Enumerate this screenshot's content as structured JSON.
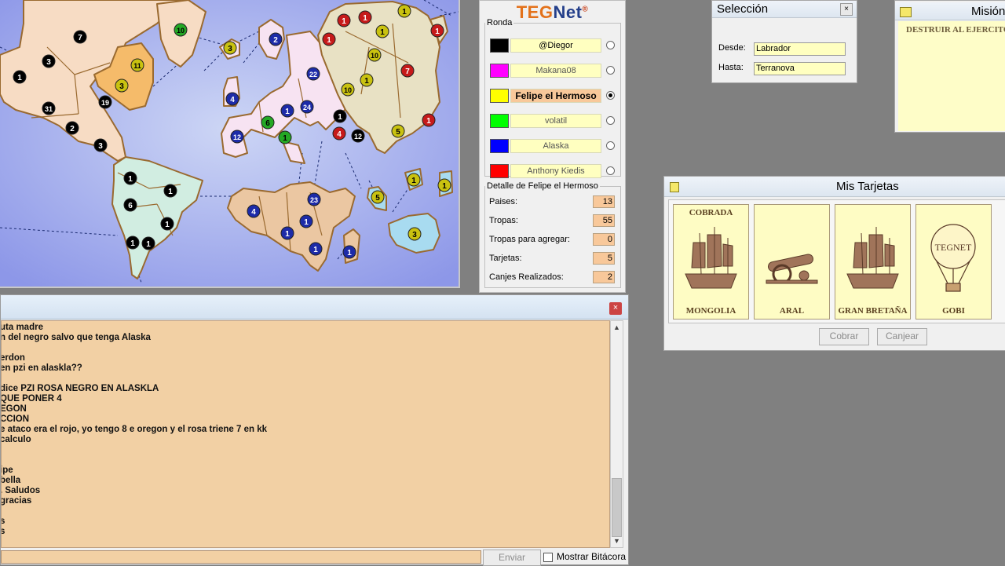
{
  "map": {
    "armies": [
      {
        "n": "7",
        "c": "black"
      },
      {
        "n": "3",
        "c": "black"
      },
      {
        "n": "1",
        "c": "black"
      },
      {
        "n": "31",
        "c": "black"
      },
      {
        "n": "19",
        "c": "black"
      },
      {
        "n": "2",
        "c": "black"
      },
      {
        "n": "3",
        "c": "black"
      },
      {
        "n": "10",
        "c": "green"
      },
      {
        "n": "11",
        "c": "yellow"
      },
      {
        "n": "3",
        "c": "yellow"
      },
      {
        "n": "3",
        "c": "yellow"
      },
      {
        "n": "2",
        "c": "blue"
      },
      {
        "n": "4",
        "c": "blue"
      },
      {
        "n": "22",
        "c": "blue"
      },
      {
        "n": "1",
        "c": "blue"
      },
      {
        "n": "24",
        "c": "blue"
      },
      {
        "n": "6",
        "c": "green"
      },
      {
        "n": "12",
        "c": "blue"
      },
      {
        "n": "1",
        "c": "green"
      },
      {
        "n": "1",
        "c": "red"
      },
      {
        "n": "1",
        "c": "red"
      },
      {
        "n": "1",
        "c": "yellow"
      },
      {
        "n": "1",
        "c": "red"
      },
      {
        "n": "1",
        "c": "red"
      },
      {
        "n": "1",
        "c": "yellow"
      },
      {
        "n": "10",
        "c": "yellow"
      },
      {
        "n": "7",
        "c": "red"
      },
      {
        "n": "1",
        "c": "yellow"
      },
      {
        "n": "10",
        "c": "yellow"
      },
      {
        "n": "1",
        "c": "black"
      },
      {
        "n": "4",
        "c": "red"
      },
      {
        "n": "12",
        "c": "black"
      },
      {
        "n": "5",
        "c": "yellow"
      },
      {
        "n": "1",
        "c": "red"
      },
      {
        "n": "1",
        "c": "black"
      },
      {
        "n": "1",
        "c": "black"
      },
      {
        "n": "6",
        "c": "black"
      },
      {
        "n": "1",
        "c": "black"
      },
      {
        "n": "1",
        "c": "black"
      },
      {
        "n": "1",
        "c": "black"
      },
      {
        "n": "4",
        "c": "blue"
      },
      {
        "n": "23",
        "c": "blue"
      },
      {
        "n": "1",
        "c": "blue"
      },
      {
        "n": "1",
        "c": "blue"
      },
      {
        "n": "1",
        "c": "blue"
      },
      {
        "n": "1",
        "c": "blue"
      },
      {
        "n": "5",
        "c": "yellow"
      },
      {
        "n": "1",
        "c": "yellow"
      },
      {
        "n": "1",
        "c": "yellow"
      },
      {
        "n": "3",
        "c": "yellow"
      }
    ]
  },
  "teg": {
    "logo_part1": "TEG",
    "logo_part2": "Net",
    "logo_mark": "®",
    "ronda_legend": "Ronda",
    "players": [
      {
        "name": "@Diegor",
        "color": "#000000",
        "active": false,
        "dark": true
      },
      {
        "name": "Makana08",
        "color": "#ff00ff",
        "active": false,
        "dark": false
      },
      {
        "name": "Felipe el Hermoso",
        "color": "#ffff00",
        "active": true,
        "dark": true
      },
      {
        "name": "volatil",
        "color": "#00ff00",
        "active": false,
        "dark": false
      },
      {
        "name": "Alaska",
        "color": "#0000ff",
        "active": false,
        "dark": false
      },
      {
        "name": "Anthony Kiedis",
        "color": "#ff0000",
        "active": false,
        "dark": false
      }
    ],
    "detalle_legend": "Detalle de Felipe el Hermoso",
    "details": [
      {
        "label": "Paises:",
        "value": "13"
      },
      {
        "label": "Tropas:",
        "value": "55"
      },
      {
        "label": "Tropas para agregar:",
        "value": "0"
      },
      {
        "label": "Tarjetas:",
        "value": "5"
      },
      {
        "label": "Canjes Realizados:",
        "value": "2"
      }
    ]
  },
  "chat": {
    "close_label": "×",
    "lines": [
      "uta madre",
      "n del negro salvo que tenga Alaska",
      "",
      "erdon",
      "en pzi en alaskla??",
      "",
      " dice PZI ROSA NEGRO EN ALASKLA",
      " QUE PONER 4",
      "EGON",
      "CCION",
      "e ataco era el rojo, yo tengo 8 e oregon y el rosa triene 7 en kk",
      " calculo",
      "",
      "",
      "ipe",
      " bella",
      ". Saludos",
      " gracias",
      "",
      "s",
      "s"
    ],
    "scroll_up": "▲",
    "scroll_down": "▼",
    "send_label": "Enviar",
    "log_label": "Mostrar Bitácora"
  },
  "seleccion": {
    "title": "Selección",
    "close_label": "×",
    "desde_label": "Desde:",
    "desde_value": "Labrador",
    "hasta_label": "Hasta:",
    "hasta_value": "Terranova"
  },
  "mision": {
    "title": "Misión",
    "text": "DESTRUIR AL EJERCITO"
  },
  "tarjetas": {
    "title": "Mis Tarjetas",
    "cards": [
      {
        "name": "MONGOLIA",
        "icon": "ship",
        "top": "COBRADA"
      },
      {
        "name": "ARAL",
        "icon": "cannon",
        "top": ""
      },
      {
        "name": "GRAN BRETAÑA",
        "icon": "ship",
        "top": ""
      },
      {
        "name": "GOBI",
        "icon": "balloon",
        "top": ""
      }
    ],
    "cobrar_label": "Cobrar",
    "canjear_label": "Canjear"
  }
}
